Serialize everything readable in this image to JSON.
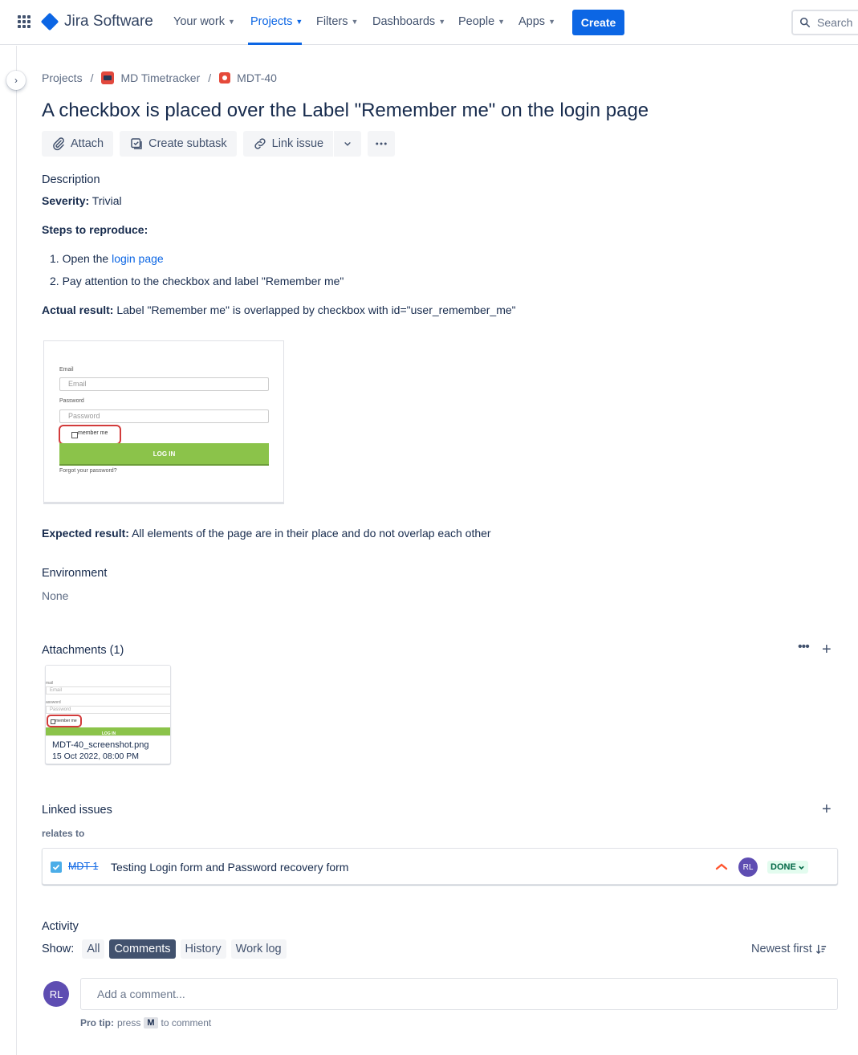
{
  "nav": {
    "product": "Jira Software",
    "items": [
      "Your work",
      "Projects",
      "Filters",
      "Dashboards",
      "People",
      "Apps"
    ],
    "active": "Projects",
    "create": "Create",
    "search_placeholder": "Search",
    "brand_color": "#0c66e4"
  },
  "breadcrumb": {
    "projects": "Projects",
    "project": "MD Timetracker",
    "issue_key": "MDT-40"
  },
  "issue": {
    "title": "A checkbox is placed over the Label \"Remember me\" on the login page",
    "actions": {
      "attach": "Attach",
      "create_subtask": "Create subtask",
      "link_issue": "Link issue"
    }
  },
  "description": {
    "heading": "Description",
    "severity_label": "Severity:",
    "severity_value": "Trivial",
    "steps_label": "Steps to reproduce:",
    "step1_prefix": "Open the",
    "step1_link": "login page",
    "step2": "Pay attention to the checkbox and label \"Remember me\"",
    "actual_label": "Actual result:",
    "actual_value": "Label \"Remember me\" is overlapped by checkbox with id=\"user_remember_me\"",
    "expected_label": "Expected result:",
    "expected_value": "All elements of the page are in their place and do not overlap each other"
  },
  "embed_screenshot": {
    "email_label": "Email",
    "email_placeholder": "Email",
    "password_label": "Password",
    "password_placeholder": "Password",
    "checkbox_label": "member me",
    "login_button": "LOG IN",
    "forgot": "Forgot your password?"
  },
  "environment": {
    "heading": "Environment",
    "value": "None"
  },
  "attachments": {
    "heading": "Attachments (1)",
    "file_name": "MDT-40_screenshot.png",
    "file_date": "15 Oct 2022, 08:00 PM",
    "thumb_email_label": "mail",
    "thumb_email": "Email",
    "thumb_password_label": "assword",
    "thumb_password": "Password",
    "thumb_checkbox": "member me",
    "thumb_login": "LOG IN"
  },
  "linked": {
    "heading": "Linked issues",
    "relation": "relates to",
    "key": "MDT-1",
    "summary": "Testing Login form and Password recovery form",
    "assignee_initials": "RL",
    "status": "DONE"
  },
  "activity": {
    "heading": "Activity",
    "show_label": "Show:",
    "filters": [
      "All",
      "Comments",
      "History",
      "Work log"
    ],
    "selected_filter": "Comments",
    "sort": "Newest first",
    "user_initials": "RL",
    "comment_placeholder": "Add a comment...",
    "protip_label": "Pro tip:",
    "protip_press": "press",
    "protip_key": "M",
    "protip_suffix": "to comment"
  }
}
